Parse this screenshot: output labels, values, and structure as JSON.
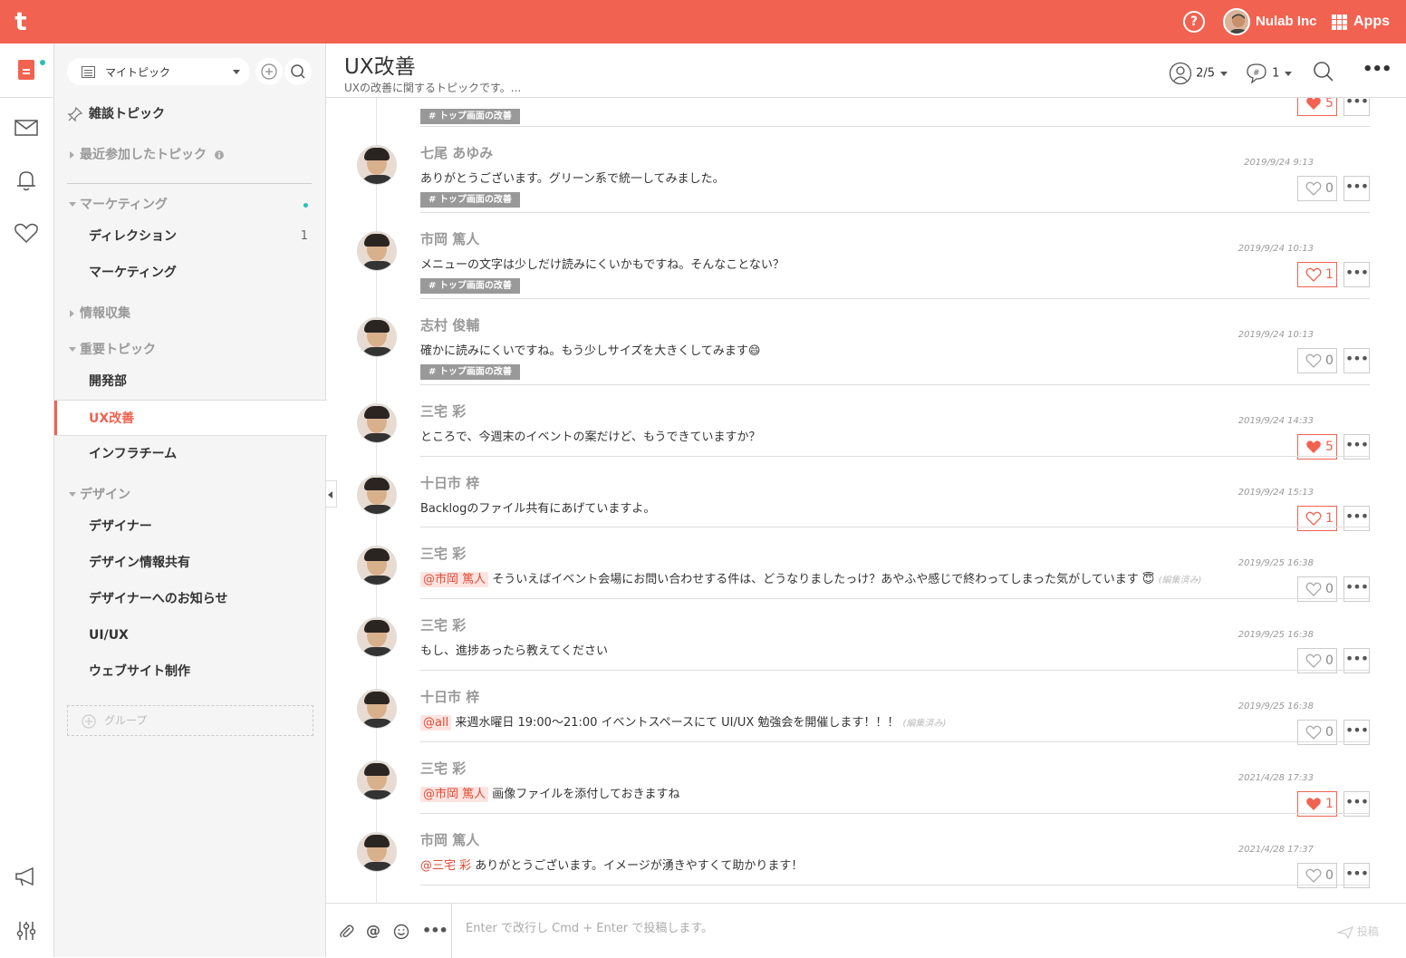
{
  "app": {
    "logo": "t",
    "org_name": "Nulab Inc",
    "apps_label": "Apps",
    "help_label": "?"
  },
  "sidebar": {
    "selector_label": "マイトピック",
    "pinned": "雑談トピック",
    "recent": "最近参加したトピック",
    "groups": [
      {
        "label": "マーケティング",
        "items": [
          {
            "label": "ディレクション",
            "count": "1"
          },
          {
            "label": "マーケティング",
            "count": ""
          }
        ]
      },
      {
        "label": "情報収集",
        "items": []
      },
      {
        "label": "重要トピック",
        "items": [
          {
            "label": "開発部"
          },
          {
            "label": "UX改善"
          },
          {
            "label": "インフラチーム"
          }
        ]
      },
      {
        "label": "デザイン",
        "items": [
          {
            "label": "デザイナー"
          },
          {
            "label": "デザイン情報共有"
          },
          {
            "label": "デザイナーへのお知らせ"
          },
          {
            "label": "UI/UX"
          },
          {
            "label": "ウェブサイト制作"
          }
        ]
      }
    ],
    "add_group": "グループ"
  },
  "header": {
    "title": "UX改善",
    "subtitle": "UXの改善に関するトピックです。...",
    "members": "2/5",
    "topics": "1"
  },
  "top_partial": {
    "tag": "# トップ画面の改善",
    "likes": "5"
  },
  "messages": [
    {
      "author": "七尾 あゆみ",
      "text": "ありがとうございます。グリーン系で統一してみました。",
      "date": "2019/9/24 9:13",
      "likes": "0",
      "liked": false,
      "tag": "# トップ画面の改善"
    },
    {
      "author": "市岡 篤人",
      "text": "メニューの文字は少しだけ読みにくいかもですね。そんなことない？",
      "date": "2019/9/24 10:13",
      "likes": "1",
      "liked": false,
      "tag": "# トップ画面の改善"
    },
    {
      "author": "志村 俊輔",
      "text": "確かに読みにくいですね。もう少しサイズを大きくしてみます😄",
      "date": "2019/9/24 10:13",
      "likes": "0",
      "liked": false,
      "tag": "# トップ画面の改善"
    },
    {
      "author": "三宅 彩",
      "text": "ところで、今週末のイベントの案だけど、もうできていますか？",
      "date": "2019/9/24 14:33",
      "likes": "5",
      "liked": true
    },
    {
      "author": "十日市 梓",
      "text": "Backlogのファイル共有にあげていますよ。",
      "date": "2019/9/24 15:13",
      "likes": "1",
      "liked": false
    },
    {
      "author": "三宅 彩",
      "mention": "@市岡 篤人",
      "text": "そういえばイベント会場にお問い合わせする件は、どうなりましたっけ？あやふや感じで終わってしまった気がしています 😇",
      "edited": "(編集済み)",
      "date": "2019/9/25 16:38",
      "likes": "0",
      "liked": false
    },
    {
      "author": "三宅 彩",
      "text": "もし、進捗あったら教えてください",
      "date": "2019/9/25 16:38",
      "likes": "0",
      "liked": false
    },
    {
      "author": "十日市 梓",
      "mention": "@all",
      "text": "来週水曜日 19:00〜21:00 イベントスペースにて UI/UX 勉強会を開催します！！！",
      "edited": "(編集済み)",
      "date": "2019/9/25 16:38",
      "likes": "0",
      "liked": false
    },
    {
      "author": "三宅 彩",
      "mention": "@市岡 篤人",
      "text": "画像ファイルを添付しておきますね",
      "date": "2021/4/28 17:33",
      "likes": "1",
      "liked": true
    },
    {
      "author": "市岡 篤人",
      "mention_plain": "@三宅 彩",
      "text": "ありがとうございます。イメージが湧きやすくて助かります！",
      "date": "2021/4/28 17:37",
      "likes": "0",
      "liked": false
    }
  ],
  "composer": {
    "placeholder": "Enter で改行し Cmd + Enter で投稿します。",
    "send_label": "投稿"
  },
  "colors": {
    "brand": "#f26250",
    "accent_teal": "#27c1b4"
  }
}
